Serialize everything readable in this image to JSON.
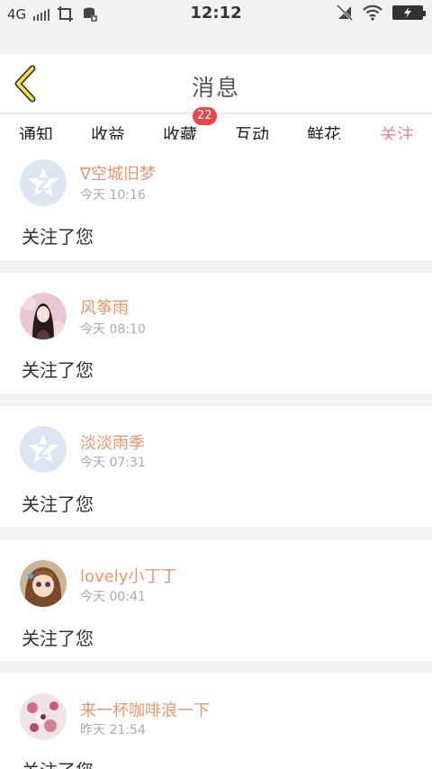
{
  "status_bar": {
    "network": "4G",
    "time": "12:12"
  },
  "header": {
    "title": "消息"
  },
  "tabs": [
    {
      "label": "通知"
    },
    {
      "label": "收益"
    },
    {
      "label": "收藏",
      "badge": "22"
    },
    {
      "label": "互动"
    },
    {
      "label": "鲜花"
    },
    {
      "label": "关注",
      "active": true
    }
  ],
  "items": [
    {
      "name": "∇空城旧梦",
      "time": "今天 10:16",
      "message": "关注了您",
      "avatar": "default-avatar-icon"
    },
    {
      "name": "风筝雨",
      "time": "今天 08:10",
      "message": "关注了您",
      "avatar": "user-photo"
    },
    {
      "name": "淡淡雨季",
      "time": "今天 07:31",
      "message": "关注了您",
      "avatar": "default-avatar-icon"
    },
    {
      "name": "lovely小丁丁",
      "time": "今天 00:41",
      "message": "关注了您",
      "avatar": "user-photo"
    },
    {
      "name": "来一杯咖啡浪一下",
      "time": "昨天 21:54",
      "message": "关注了您",
      "avatar": "user-photo"
    }
  ],
  "colors": {
    "accent": "#e580a6",
    "username": "#e8956a",
    "badge": "#e8454d"
  }
}
